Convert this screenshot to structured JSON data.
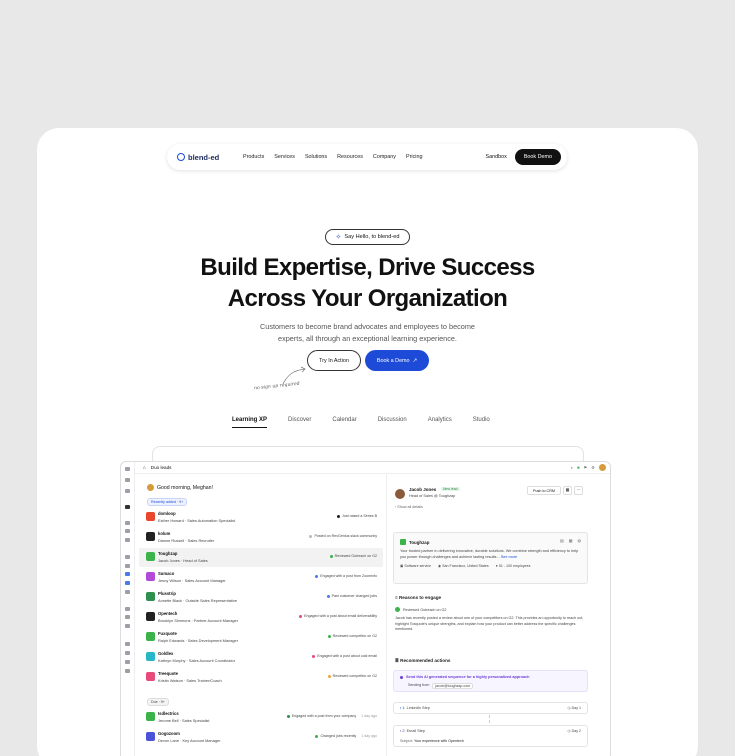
{
  "nav": {
    "logo_text": "blend-ed",
    "links": [
      "Products",
      "Services",
      "Solutions",
      "Resources",
      "Company",
      "Pricing"
    ],
    "sandbox": "Sandbox",
    "book_demo": "Book Demo"
  },
  "hero": {
    "pill": "Say Hello, to blend-ed",
    "title_line1": "Build Expertise, Drive Success",
    "title_line2": "Across Your Organization",
    "subtitle_line1": "Customers to become brand advocates and employees to become",
    "subtitle_line2": "experts, all through an exceptional learning experience.",
    "try_button": "Try In Action",
    "demo_button": "Book a Demo",
    "note": "no sign up required"
  },
  "tabs": [
    "Learning XP",
    "Discover",
    "Calendar",
    "Discussion",
    "Analytics",
    "Studio"
  ],
  "app": {
    "page_title": "Duo leads",
    "greeting": "Good morning, Meghan!",
    "recently_added": "Recently added · 9+",
    "due": "Due · 9+",
    "leads": [
      {
        "company": "domloop",
        "person": "Esther Howard · Sales Automation Specialist",
        "status": "Just raised a Series B",
        "color": "#e8462d",
        "dot": "#222"
      },
      {
        "company": "kolum",
        "person": "Dianne Russell · Sales Recruiter",
        "status": "Posted on RevGenius slack community",
        "color": "#222",
        "dot": "#bbb"
      },
      {
        "company": "Toughzap",
        "person": "Jacob Jones · Head of Sales",
        "status": "Reviewed Outreach on G2",
        "color": "#3bb34a",
        "dot": "#3bb34a"
      },
      {
        "company": "Sumaco",
        "person": "Jenny Wilson · Sales Account Manager",
        "status": "Engaged with a post from Zoominfo",
        "color": "#b14ad9",
        "dot": "#4a7be8"
      },
      {
        "company": "Plusstrip",
        "person": "Annette Black · Outside Sales Representative",
        "status": "Past customer changed jobs",
        "color": "#2e8f4e",
        "dot": "#4a7be8"
      },
      {
        "company": "Opentech",
        "person": "Brooklyn Simmons · Partner Account Manager",
        "status": "Engaged with a post about email deliverability",
        "color": "#222",
        "dot": "#e84a7b"
      },
      {
        "company": "Fuxquote",
        "person": "Ralph Edwards · Sales Development Manager",
        "status": "Reviewed competitor on G2",
        "color": "#3bb34a",
        "dot": "#3bb34a"
      },
      {
        "company": "Goldlex",
        "person": "Kathryn Murphy · Sales Account Coordinator",
        "status": "Engaged with a post about cold email",
        "color": "#29b6c6",
        "dot": "#e84a7b"
      },
      {
        "company": "Treequote",
        "person": "Kristin Watson · Sales Trainer/Coach",
        "status": "Reviewed competitor on G2",
        "color": "#e84a7b",
        "dot": "#f0a33a"
      }
    ],
    "due_leads": [
      {
        "company": "Isdlectrics",
        "person": "Jerome Bell · Sales Specialist",
        "status": "Engaged with a post from your company",
        "time": "1 day ago",
        "color": "#3bb34a",
        "dot": "#2e8f4e"
      },
      {
        "company": "Gogozoom",
        "person": "Devon Lane · Key Account Manager",
        "status": "Changed jobs recently",
        "time": "1 day ago",
        "color": "#4a52d9",
        "dot": "#3bb34a"
      }
    ],
    "detail": {
      "name": "Jacob Jones",
      "badge": "New lead",
      "role": "Head of Sales @ Toughzap",
      "push": "Push to CRM",
      "show_details": "Show all details",
      "company": "Toughzap",
      "about": "Your trusted partner in delivering innovative, durable solutions. We combine strength and efficiency to help you power through challenges and achieve lasting results...",
      "see_more": "See more",
      "industry": "Software service",
      "location": "San Francisco, United States",
      "employees": "51 - 100 employees",
      "reasons_title": "Reasons to engage",
      "reason_item": "Reviewed Outreach on G2",
      "reason_text": "Jacob has recently posted a review about one of your competitors on G2. This provides an opportunity to reach out, highlight Toxquote's unique strengths, and explain how your product can better address the specific challenges mentioned.",
      "actions_title": "Recommended actions",
      "action_main": "Send this AI generated sequence for a highly personalized approach",
      "sending_from_label": "Sending from",
      "sending_from": "jacob@toughzap.com",
      "step1": "1. LinkedIn Step",
      "step1_day": "Day 1",
      "step2": "2. Email Step",
      "step2_day": "Day 2",
      "subject_label": "Subject:",
      "subject": "Your experience with Opentech"
    }
  }
}
